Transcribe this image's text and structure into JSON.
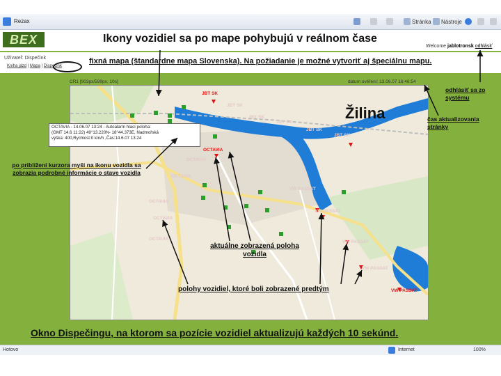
{
  "browser": {
    "tab_title": "Rezax",
    "toolbar": {
      "page": "Stránka",
      "tools": "Nástroje"
    },
    "status_left": "Hotovo",
    "status_zone": "Internet",
    "zoom": "100%"
  },
  "page": {
    "title": "Ikony vozidiel sa po mape pohybujú v reálnom čase",
    "welcome_prefix": "Welcome",
    "welcome_user": "jablotronsk",
    "logout_link": "odhlásiť",
    "user_label": "Užívateľ: Dispečink",
    "nav_links": [
      "Kniha jázd",
      "Mapa",
      "Dispečink"
    ],
    "fixed_map_note": "fixná mapa (štandardne mapa Slovenska). Na požiadanie je možné vytvoriť aj špeciálnu mapu.",
    "cr_label": "CR1 [903px/599px, 10s]",
    "datum_label": "datum ověření: 13.06.07 16:46:54",
    "city_label": "Žilina",
    "popup": {
      "line1": "OCTAVIA - 14.06.07 13:24 - Autoalarm hlasí poloha:",
      "line2": "(GMT 14.6 11:22) 49°13.220N- 18°44.373E, Nadmořská",
      "line3": "výška: 400,Rychlost:0 km/h ,Čas:14.6.07 13:24"
    },
    "vehicle_labels": {
      "jbt_top": "JBT SK",
      "jbt1": "JBT SK",
      "jbt2": "JBT SK",
      "jbt3": "JBT SK",
      "jbt4": "JBT SK",
      "jbt5": "JBT SK",
      "octavia_current": "OCTAVIA",
      "octavia_trail1": "OCTAVIA",
      "octavia_trail2": "OCTAVIA",
      "octavia_trail3": "OCTAVIA",
      "octavia_trail4": "OCTAVIA",
      "octavia_trail5": "OCTAVIA",
      "vw1": "VW PASSAT",
      "vw2": "VW PASSAT",
      "vw3": "VW PASSAT",
      "vw4": "VW PASSAT",
      "vw_current": "VW PASSAT"
    },
    "callouts": {
      "logout": "odhlásiť sa zo systému",
      "refresh_time": "čas aktualizovania stránky",
      "hover_info": "po priblížení kurzora myši na ikonu vozidla sa zobrazia podrobné informácie o stave vozidla",
      "current_position": "aktuálne zobrazená poloha vozidla",
      "previous_positions": "polohy vozidiel, ktoré boli zobrazené predtým"
    },
    "bottom_caption": "Okno Dispečingu, na ktorom sa pozície vozidiel aktualizujú každých 10 sekúnd."
  },
  "colors": {
    "background_green": "#84b13e",
    "logo_dark_green": "#3e6e1d",
    "river_blue": "#1f7dd8",
    "vehicle_red": "#e11111"
  }
}
